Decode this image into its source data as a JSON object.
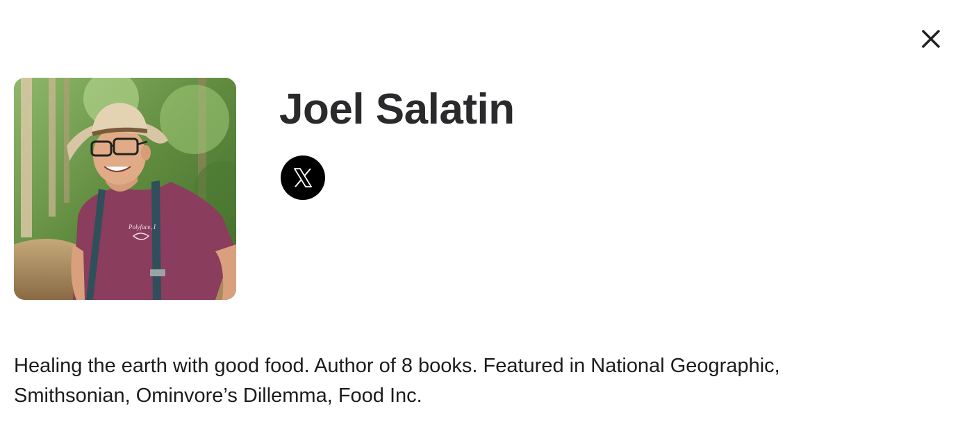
{
  "header": {
    "close_icon": "close-icon"
  },
  "profile": {
    "name": "Joel Salatin",
    "avatar_icon": "person-photo",
    "social": [
      {
        "network": "X",
        "icon": "x-logo-icon",
        "color": "#000000"
      }
    ],
    "bio": "Healing the earth with good food. Author of 8 books. Featured in National Geographic, Smithsonian, Ominvore’s Dillemma, Food Inc."
  },
  "colors": {
    "text": "#1c1c1e",
    "heading": "#2a2a2c",
    "background": "#ffffff"
  }
}
